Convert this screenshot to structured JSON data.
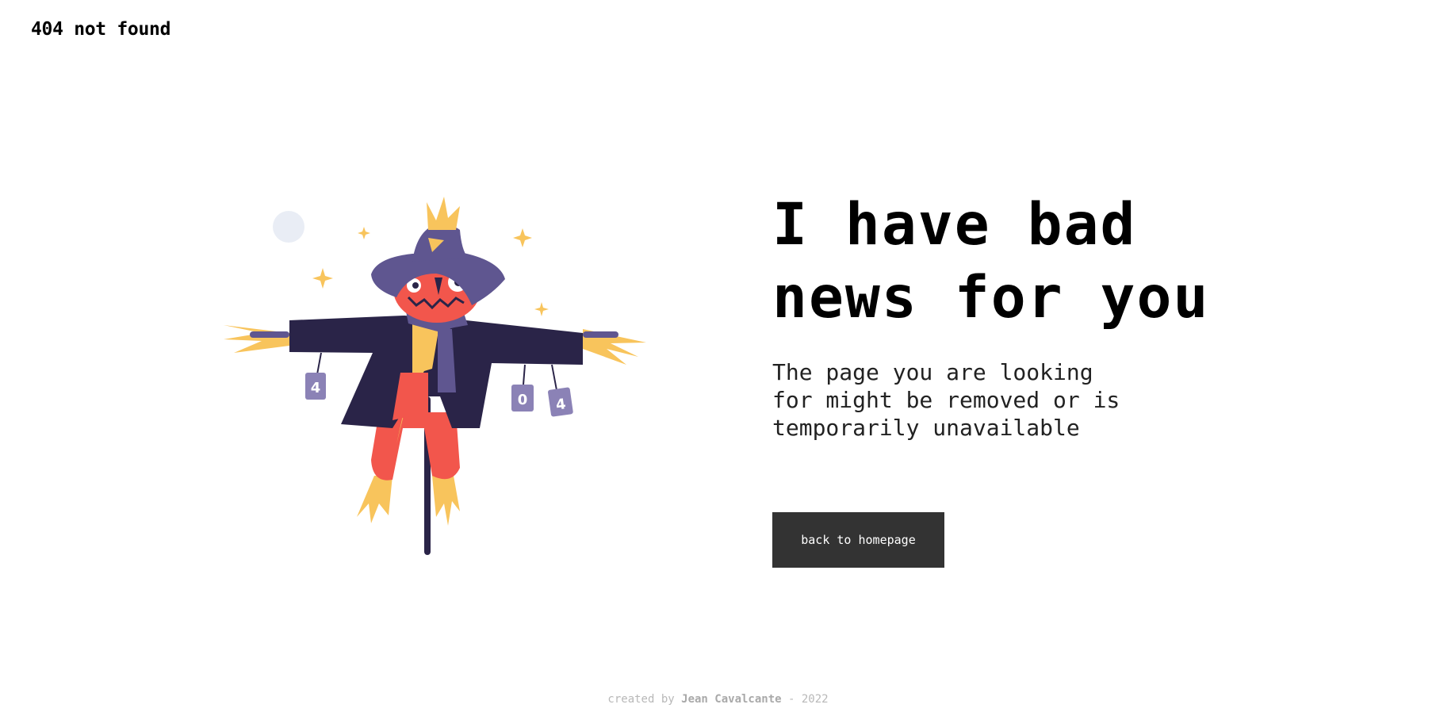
{
  "header": {
    "brand": "404 not found"
  },
  "main": {
    "headline": "I have bad\nnews for you",
    "subtext": "The page you are looking\nfor might be removed or is\ntemporarily unavailable",
    "button_label": "back to homepage"
  },
  "illustration": {
    "can_labels": [
      "4",
      "0",
      "4"
    ]
  },
  "footer": {
    "prefix": "created by",
    "author": "Jean Cavalcante",
    "suffix": "- 2022"
  },
  "colors": {
    "button_bg": "#333333",
    "coat": "#2a2448",
    "hat": "#5f5690",
    "face": "#f2564c",
    "straw": "#f8c45c",
    "moon": "#e9edf5"
  }
}
